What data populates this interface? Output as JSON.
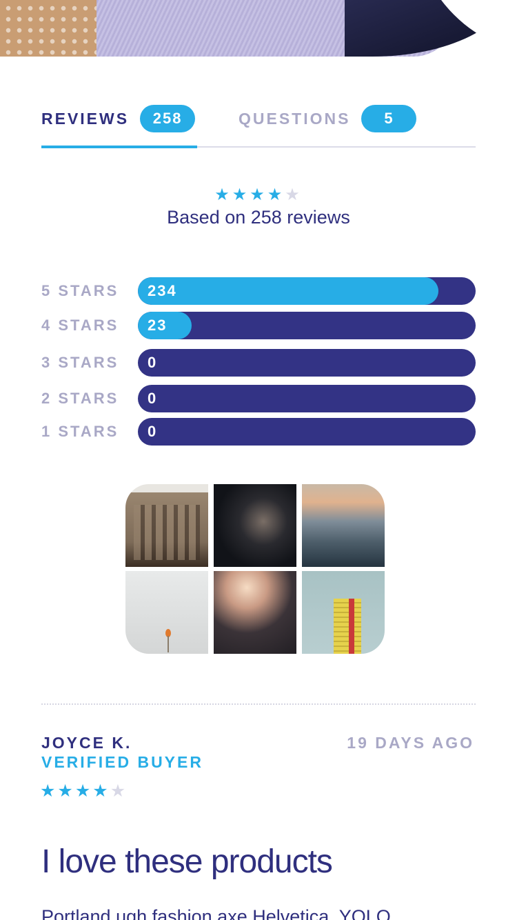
{
  "tabs": {
    "reviews": {
      "label": "REVIEWS",
      "count": "258"
    },
    "questions": {
      "label": "QUESTIONS",
      "count": "5"
    }
  },
  "summary": {
    "rating": 4,
    "max_rating": 5,
    "stars_icon": "star-icon",
    "text": "Based on 258 reviews"
  },
  "breakdown": [
    {
      "label": "5 STARS",
      "count": "234",
      "fraction": 0.89
    },
    {
      "label": "4 STARS",
      "count": "23",
      "fraction": 0.16
    },
    {
      "label": "3 STARS",
      "count": "0",
      "fraction": 0
    },
    {
      "label": "2 STARS",
      "count": "0",
      "fraction": 0
    },
    {
      "label": "1 STARS",
      "count": "0",
      "fraction": 0
    }
  ],
  "gallery": {
    "photos": [
      "building-photo",
      "portrait-photo",
      "clouds-photo",
      "flower-photo",
      "person-photo",
      "tower-photo"
    ]
  },
  "review": {
    "author": "JOYCE K.",
    "badge": "VERIFIED BUYER",
    "date": "19 DAYS AGO",
    "rating": 4,
    "title": "I love these products",
    "body": "Portland ugh fashion axe Helvetica, YOLO"
  },
  "colors": {
    "accent": "#27ade6",
    "primary": "#2f2f7e",
    "muted": "#a9a8c6",
    "bar_track": "#333385"
  }
}
